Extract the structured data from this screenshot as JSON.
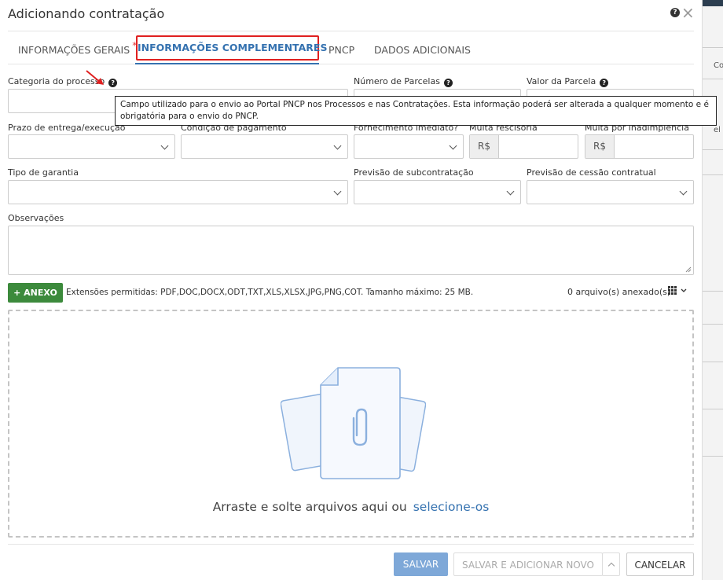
{
  "window": {
    "title": "Adicionando contratação"
  },
  "tabs": [
    {
      "label": "INFORMAÇÕES GERAIS",
      "required_marker": "*"
    },
    {
      "label": "INFORMAÇÕES COMPLEMENTARES"
    },
    {
      "label": "PNCP"
    },
    {
      "label": "DADOS ADICIONAIS"
    }
  ],
  "active_tab": "INFORMAÇÕES COMPLEMENTARES",
  "fields": {
    "categoria": {
      "label": "Categoria do processo",
      "value": ""
    },
    "numero_parcelas": {
      "label": "Número de Parcelas",
      "value": ""
    },
    "valor_parcela": {
      "label": "Valor da Parcela",
      "value": ""
    },
    "prazo_entrega": {
      "label": "Prazo de entrega/execução",
      "value": ""
    },
    "condicao_pagamento": {
      "label": "Condição de pagamento",
      "value": ""
    },
    "fornecimento_imediato": {
      "label": "Fornecimento imediato?",
      "value": ""
    },
    "multa_rescisoria": {
      "label": "Multa rescisória",
      "prefix": "R$",
      "value": ""
    },
    "multa_inadimplencia": {
      "label": "Multa por inadimplência",
      "prefix": "R$",
      "value": ""
    },
    "tipo_garantia": {
      "label": "Tipo de garantia",
      "value": ""
    },
    "previsao_subcontratacao": {
      "label": "Previsão de subcontratação",
      "value": ""
    },
    "previsao_cessao": {
      "label": "Previsão de cessão contratual",
      "value": ""
    },
    "observacoes": {
      "label": "Observações",
      "value": ""
    }
  },
  "tooltip": {
    "line1": "Campo utilizado para o envio ao Portal PNCP nos Processos e nas Contratações. Esta informação poderá ser alterada a qualquer momento e é",
    "line2": "obrigatória para o envio do PNCP."
  },
  "attachments": {
    "button_label": "+ ANEXO",
    "extensions_text": "Extensões permitidas: PDF,DOC,DOCX,ODT,TXT,XLS,XLSX,JPG,PNG,COT. Tamanho máximo: 25 MB.",
    "count_text": "0 arquivo(s) anexado(s)",
    "dropzone_text": "Arraste e solte arquivos aqui ou",
    "dropzone_link": "selecione-os"
  },
  "footer": {
    "save_label": "SALVAR",
    "save_add_label": "SALVAR E ADICIONAR NOVO",
    "cancel_label": "CANCELAR"
  },
  "background": {
    "fragment_1": "Co",
    "fragment_2": "el"
  },
  "colors": {
    "accent": "#3572b0",
    "highlight_box": "#e02020",
    "anexo_button": "#3c8a3c",
    "save_button": "#7ea8d8"
  }
}
